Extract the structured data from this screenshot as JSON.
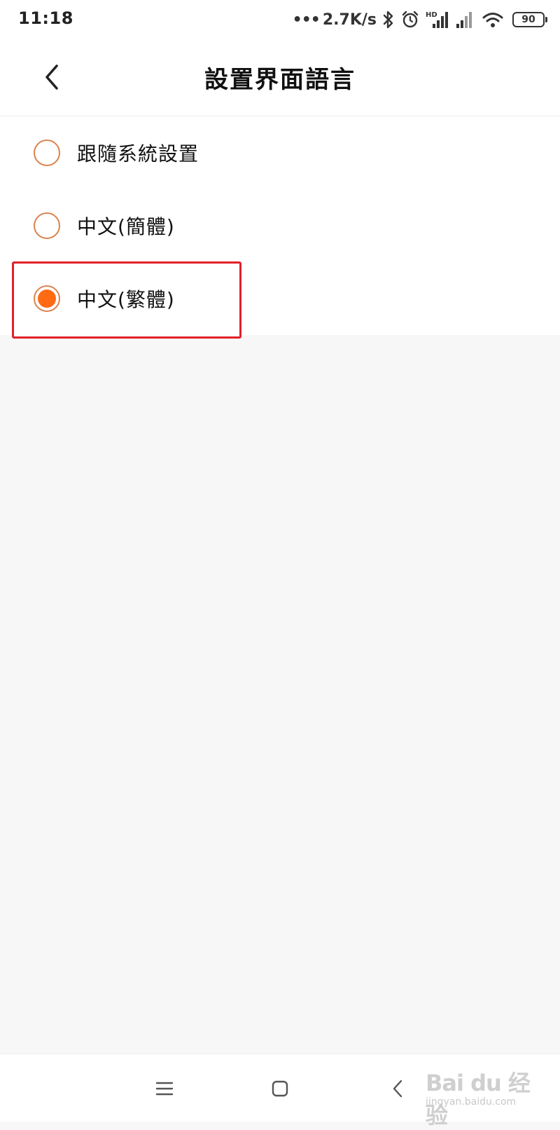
{
  "status_bar": {
    "time": "11:18",
    "dots": "•••",
    "net_speed": "2.7K/s",
    "battery_level": "90",
    "icons": [
      "bluetooth-icon",
      "alarm-icon",
      "hd-signal-icon",
      "signal-icon",
      "wifi-icon",
      "battery-icon"
    ]
  },
  "header": {
    "back_icon": "chevron-left-icon",
    "title": "設置界面語言"
  },
  "options": [
    {
      "label": "跟隨系統設置",
      "selected": false
    },
    {
      "label": "中文(簡體)",
      "selected": false
    },
    {
      "label": "中文(繁體)",
      "selected": true
    }
  ],
  "colors": {
    "accent": "#ff6a13",
    "radio_border": "#d9834f",
    "highlight": "#e3202a",
    "background": "#f7f7f7"
  },
  "nav_bar": {
    "icons": [
      "menu-icon",
      "home-icon",
      "back-icon"
    ]
  },
  "watermark": {
    "main": "Bai du 经验",
    "sub": "jingyan.baidu.com"
  }
}
